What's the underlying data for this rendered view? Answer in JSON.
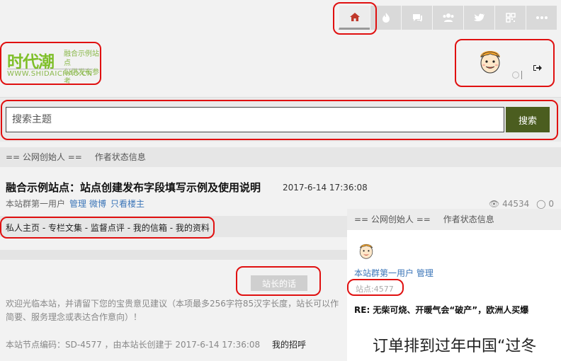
{
  "nav": {
    "tabs": [
      {
        "icon": "home-icon",
        "active": true
      },
      {
        "icon": "fire-icon",
        "active": false
      },
      {
        "icon": "chat-icon",
        "active": false
      },
      {
        "icon": "users-icon",
        "active": false
      },
      {
        "icon": "twitter-icon",
        "active": false
      },
      {
        "icon": "qrcode-icon",
        "active": false
      },
      {
        "icon": "more-icon",
        "active": false
      }
    ],
    "active_color": "#c0392b"
  },
  "logo": {
    "name": "时代潮",
    "tagline_1": "融合示例站点",
    "tagline_2": "仅供发布参考",
    "url": "WWW.SHIDAICHAO.CN",
    "color": "#7fbf2a"
  },
  "search": {
    "placeholder": "搜索主题",
    "button_label": "搜索",
    "button_color": "#4b5d1f"
  },
  "section": {
    "founder": "== 公网创始人 ==",
    "status": "作者状态信息"
  },
  "post": {
    "title": "融合示例站点：站点创建发布字段填写示例及使用说明",
    "date": "2017-6-14 17:36:08",
    "author": "本站群第一用户",
    "link_manage": "管理",
    "link_weibo": "微博",
    "link_owner": "只看楼主",
    "views": "44534",
    "comments": "0"
  },
  "menu": {
    "text": "私人主页 - 专栏文集 - 监督点评 - 我的信箱 - 我的资料"
  },
  "message": {
    "button_label": "站长的话",
    "welcome": "欢迎光临本站，并请留下您的宝贵意见建议（本项最多256字符85汉字长度，站长可以作简要、服务理念或表达合作意向）！",
    "node_note": "本站节点编码：SD-4577 ，由本站长创建于 2017-6-14 17:36:08",
    "greeting": "我的招呼"
  },
  "popup": {
    "founder": "== 公网创始人 ==",
    "status": "作者状态信息",
    "user": "本站群第一用户",
    "manage": "管理",
    "points": "站点:4577",
    "reply": "RE: 无柴可烧、开暖气会“破产”，欧洲人买爆",
    "headline": "订单排到过年中国“过冬"
  }
}
